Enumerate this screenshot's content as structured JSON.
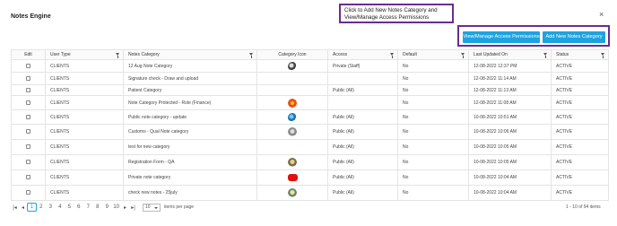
{
  "dialog": {
    "title": "Notes Engine",
    "close_label": "×"
  },
  "callout": {
    "text": "Click to Add New Notes Category and View/Manage Access Permissions"
  },
  "buttons": {
    "manage": "View/Manage Access Permissions",
    "add": "Add New Notes Category"
  },
  "table": {
    "headers": [
      "Edit",
      "User Type",
      "Notes Category",
      "Category Icon",
      "Access",
      "Default",
      "Last Updated On",
      "Status"
    ],
    "rows": [
      {
        "user_type": "CLIENTS",
        "category": "12 Aug Note Category",
        "icon": "dark-icon",
        "access": "Private (Staff)",
        "default": "No",
        "updated": "12-08-2022 12:37 PM",
        "status": "ACTIVE"
      },
      {
        "user_type": "CLIENTS",
        "category": "Signature check - Draw and upload",
        "icon": "",
        "access": "",
        "default": "No",
        "updated": "12-08-2022 11:14 AM",
        "status": "ACTIVE"
      },
      {
        "user_type": "CLIENTS",
        "category": "Patient Category",
        "icon": "",
        "access": "Public (All)",
        "default": "No",
        "updated": "12-08-2022 11:13 AM",
        "status": "ACTIVE"
      },
      {
        "user_type": "CLIENTS",
        "category": "Note Category Protected - Role (Finance)",
        "icon": "flower-icon",
        "access": "",
        "default": "No",
        "updated": "12-08-2022 11:08 AM",
        "status": "ACTIVE"
      },
      {
        "user_type": "CLIENTS",
        "category": "Public note category - update",
        "icon": "bird-icon",
        "access": "Public (All)",
        "default": "No",
        "updated": "10-08-2022 10:51 AM",
        "status": "ACTIVE"
      },
      {
        "user_type": "CLIENTS",
        "category": "Customs - Qual Note category",
        "icon": "fan-icon",
        "access": "Public (All)",
        "default": "No",
        "updated": "10-08-2022 10:06 AM",
        "status": "ACTIVE"
      },
      {
        "user_type": "CLIENTS",
        "category": "test for new category",
        "icon": "",
        "access": "Public (All)",
        "default": "No",
        "updated": "10-08-2022 10:05 AM",
        "status": "ACTIVE"
      },
      {
        "user_type": "CLIENTS",
        "category": "Registration Form - QA",
        "icon": "owl-icon",
        "access": "Public (All)",
        "default": "No",
        "updated": "10-08-2022 10:05 AM",
        "status": "ACTIVE"
      },
      {
        "user_type": "CLIENTS",
        "category": "Private note category",
        "icon": "red-icon",
        "access": "Public (All)",
        "default": "No",
        "updated": "10-08-2022 10:04 AM",
        "status": "ACTIVE"
      },
      {
        "user_type": "CLIENTS",
        "category": "check new notes - 25july",
        "icon": "face-icon",
        "access": "Public (All)",
        "default": "No",
        "updated": "10-08-2022 10:04 AM",
        "status": "ACTIVE"
      }
    ]
  },
  "pager": {
    "first": "|◂",
    "prev": "◂",
    "next": "▸",
    "last": "▸|",
    "pages": [
      "1",
      "2",
      "3",
      "4",
      "5",
      "6",
      "7",
      "8",
      "9",
      "10"
    ],
    "active_page": "1",
    "page_size": "10",
    "page_size_label": "items per page",
    "info": "1 - 10 of 94 items"
  },
  "colors": {
    "accent": "#1ea3e0",
    "callout_border": "#6a2c91"
  }
}
